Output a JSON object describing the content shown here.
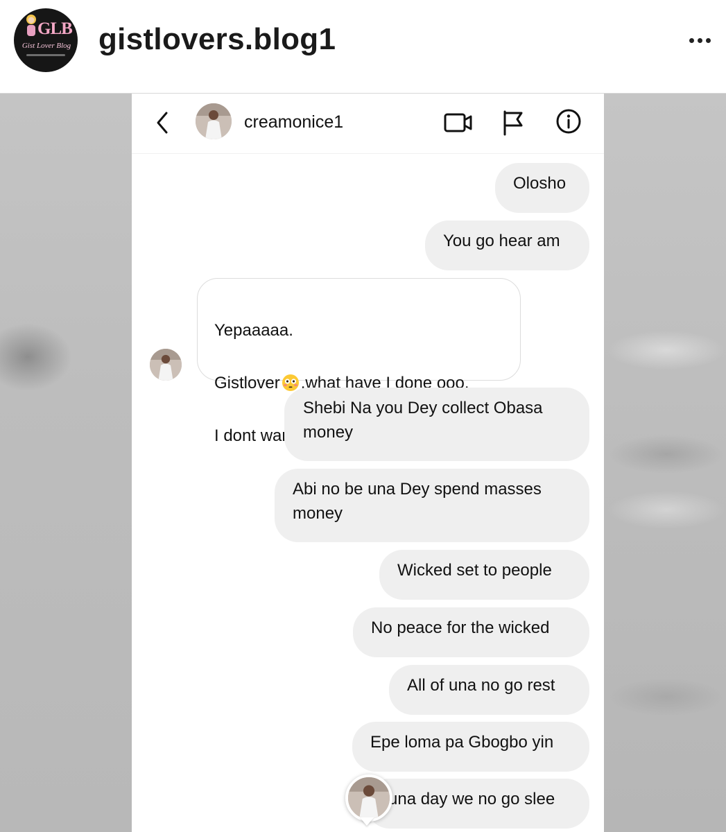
{
  "post": {
    "account_name": "gistlovers.blog1",
    "avatar_text": "GLB",
    "avatar_subtext": "Gist Lover Blog"
  },
  "dm": {
    "contact_name": "creamonice1",
    "icons": [
      "back-icon",
      "video-call-icon",
      "flag-icon",
      "info-icon"
    ],
    "messages": [
      {
        "from": "me",
        "text": "Olosho"
      },
      {
        "from": "me",
        "text": "You go hear am"
      },
      {
        "from": "them",
        "lines": [
          "Yepaaaaa.",
          "Gistlover",
          ",what have I done ooo.",
          "I dont want your trouble"
        ]
      },
      {
        "from": "me",
        "text": "Shebi Na you Dey collect Obasa\nmoney"
      },
      {
        "from": "me",
        "text": "Abi no be una Dey spend masses\nmoney"
      },
      {
        "from": "me",
        "text": "Wicked set to people"
      },
      {
        "from": "me",
        "text": "No peace for the wicked"
      },
      {
        "from": "me",
        "text": "All of una no go rest"
      },
      {
        "from": "me",
        "text": "Epe loma pa Gbogbo yin"
      },
      {
        "from": "me",
        "text": "una day we no go slee"
      }
    ]
  },
  "colors": {
    "outgoing_bubble": "#efefef",
    "incoming_border": "#dcdcdc",
    "backdrop": "#bdbdbd"
  }
}
